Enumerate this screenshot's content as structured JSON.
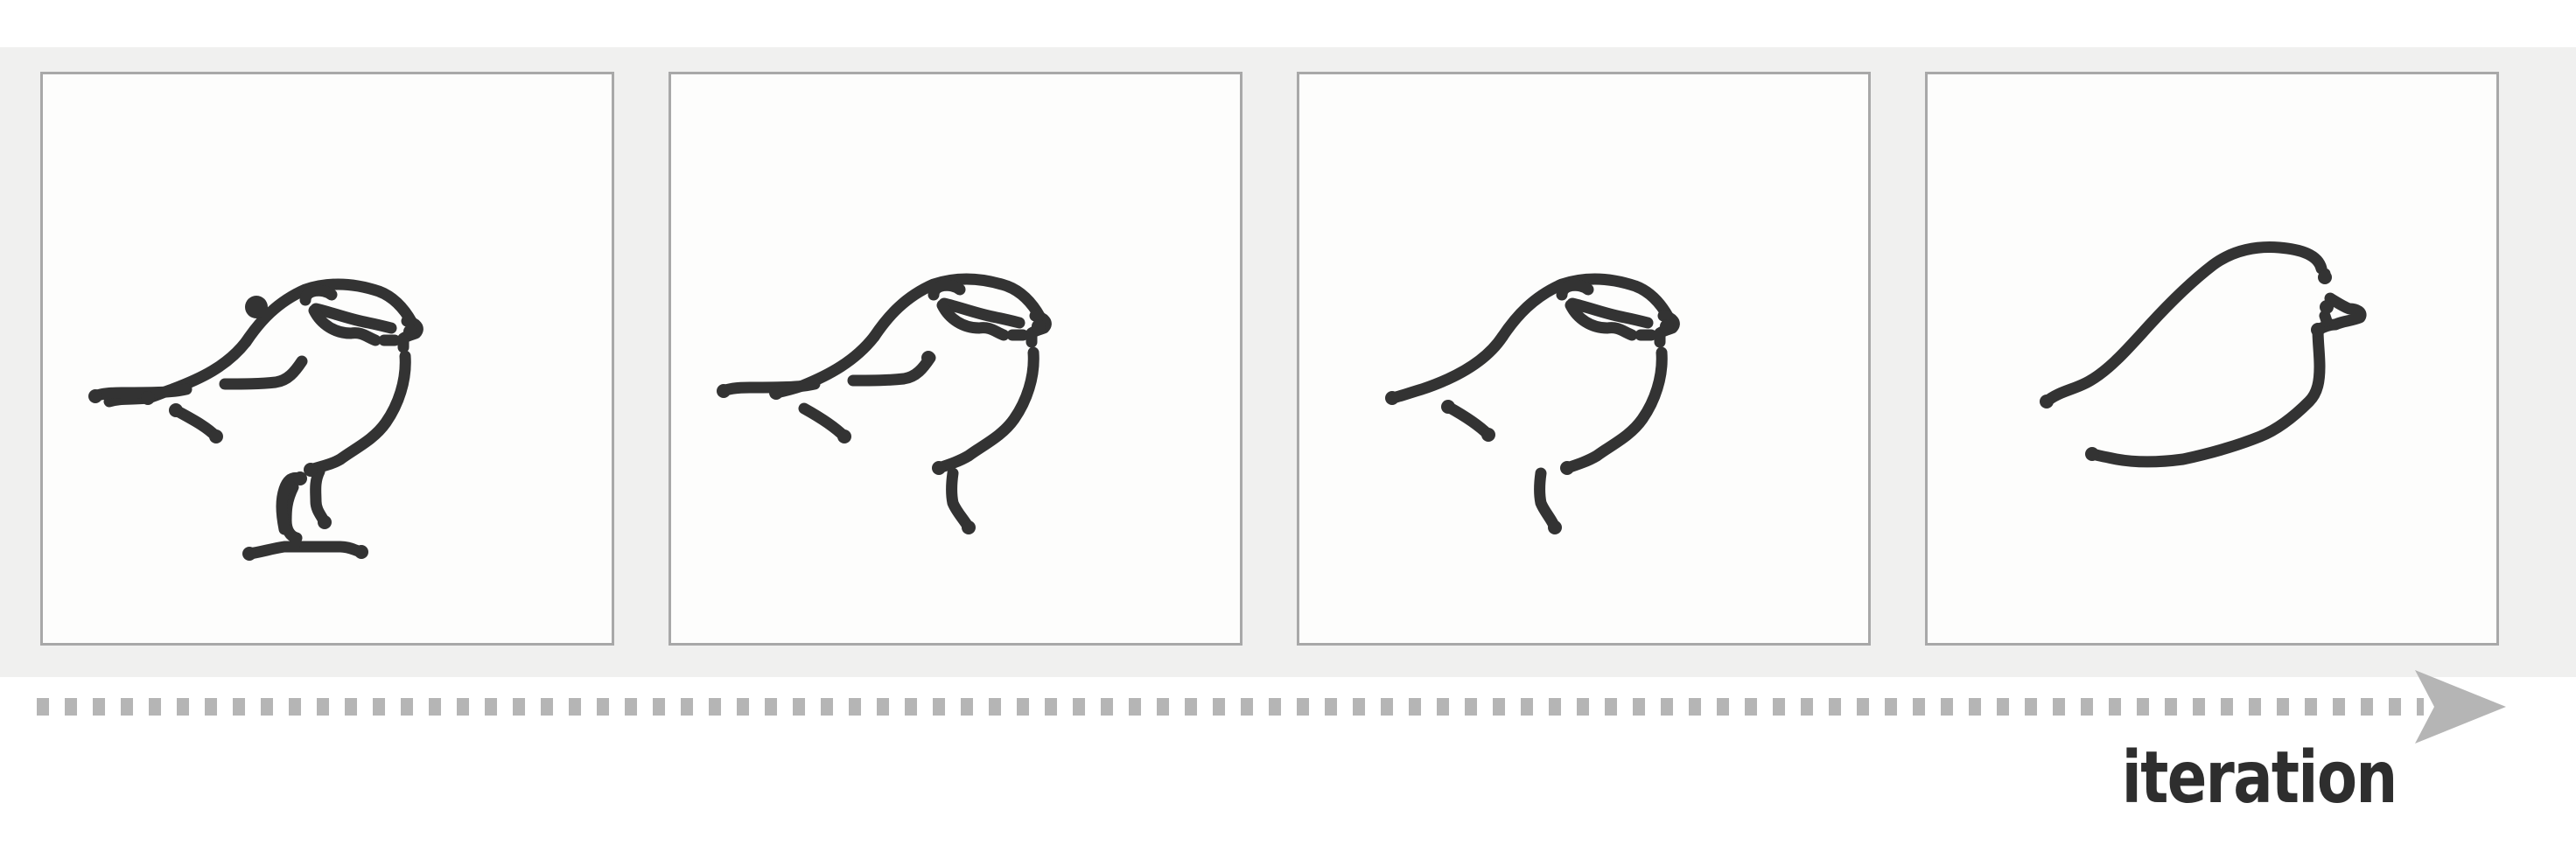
{
  "diagram": {
    "panels": [
      {
        "id": "step-1",
        "strokes": 15
      },
      {
        "id": "step-2",
        "strokes": 12
      },
      {
        "id": "step-3",
        "strokes": 9
      },
      {
        "id": "step-4",
        "strokes": 5
      }
    ],
    "axis_label": "iteration",
    "colors": {
      "band": "#f0f0ef",
      "panel_border": "#a8a8a8",
      "stroke": "#333333",
      "arrow": "#b5b5b5",
      "label": "#2e2e2e"
    }
  }
}
